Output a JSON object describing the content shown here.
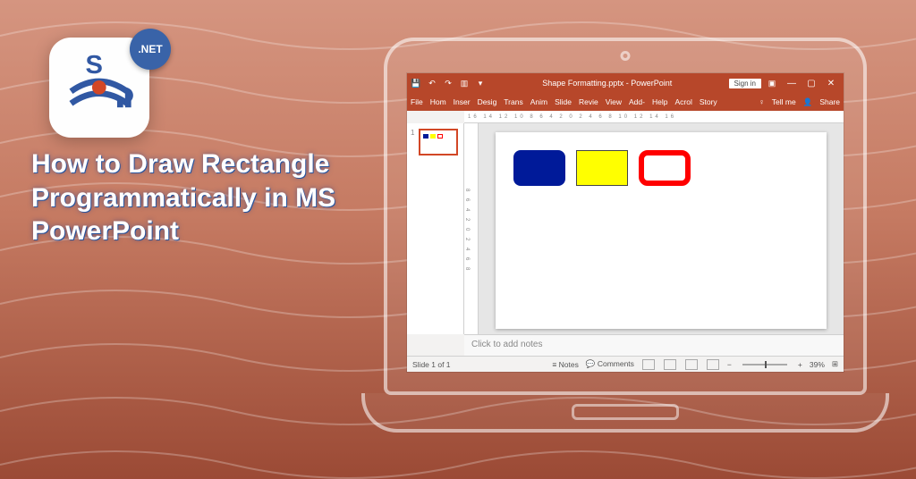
{
  "hero": {
    "title": "How to Draw Rectangle Programmatically in MS PowerPoint"
  },
  "logo": {
    "letter": "S",
    "badge": ".NET"
  },
  "titlebar": {
    "doc": "Shape Formatting.pptx - PowerPoint",
    "signin": "Sign in"
  },
  "ribbon": {
    "tabs": [
      "File",
      "Hom",
      "Inser",
      "Desig",
      "Trans",
      "Anim",
      "Slide",
      "Revie",
      "View",
      "Add-",
      "Help",
      "Acrol",
      "Story"
    ],
    "tellme": "Tell me",
    "share": "Share"
  },
  "ruler": "16  14  12  10  8  6  4  2  0  2  4  6  8  10  12  14  16",
  "ruler_v": "8 6 4 2 0 2 4 6 8",
  "thumb": {
    "number": "1"
  },
  "notes": {
    "placeholder": "Click to add notes"
  },
  "status": {
    "slide": "Slide 1 of 1",
    "notes": "Notes",
    "comments": "Comments",
    "zoom": "39%"
  },
  "shapes": [
    {
      "name": "rect-navy",
      "fill": "#001a99",
      "rounded": true
    },
    {
      "name": "rect-yellow",
      "fill": "#ffff00",
      "rounded": false
    },
    {
      "name": "rect-redoutline",
      "fill": "#ffffff",
      "border": "#ff0000",
      "rounded": true
    }
  ]
}
